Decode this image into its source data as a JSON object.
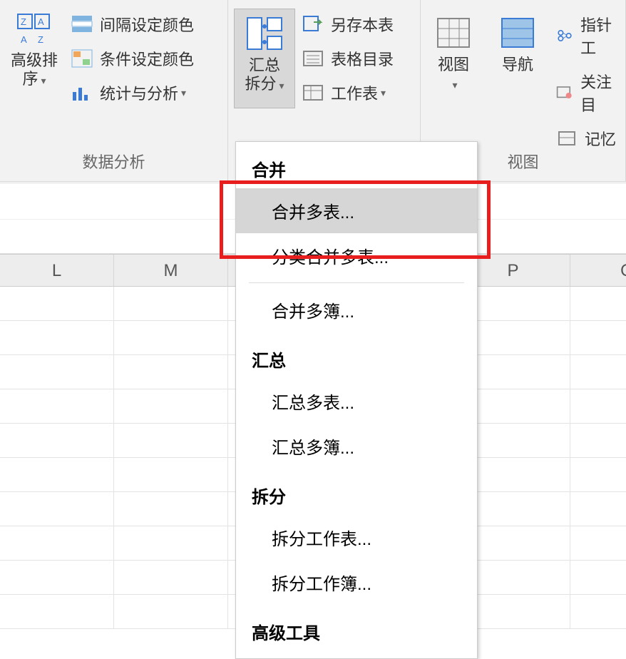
{
  "ribbon": {
    "group1": {
      "label": "数据分析",
      "sort_btn": "高级排序",
      "interval_color": "间隔设定颜色",
      "condition_color": "条件设定颜色",
      "stats_analysis": "统计与分析"
    },
    "group2": {
      "summary_split": "汇总拆分",
      "save_as_sheet": "另存本表",
      "table_contents": "表格目录",
      "worksheet": "工作表"
    },
    "group3": {
      "label": "视图",
      "view": "视图",
      "nav": "导航",
      "pointer": "指针工",
      "follow": "关注目",
      "memory": "记忆"
    }
  },
  "dropdown": {
    "sec_merge": "合并",
    "merge_sheets": "合并多表...",
    "category_merge": "分类合并多表...",
    "merge_workbooks": "合并多簿...",
    "sec_summary": "汇总",
    "summary_sheets": "汇总多表...",
    "summary_workbooks": "汇总多簿...",
    "sec_split": "拆分",
    "split_sheet": "拆分工作表...",
    "split_workbook": "拆分工作簿...",
    "sec_advanced": "高级工具"
  },
  "columns": [
    "L",
    "M",
    "",
    "",
    "P",
    "Q"
  ]
}
